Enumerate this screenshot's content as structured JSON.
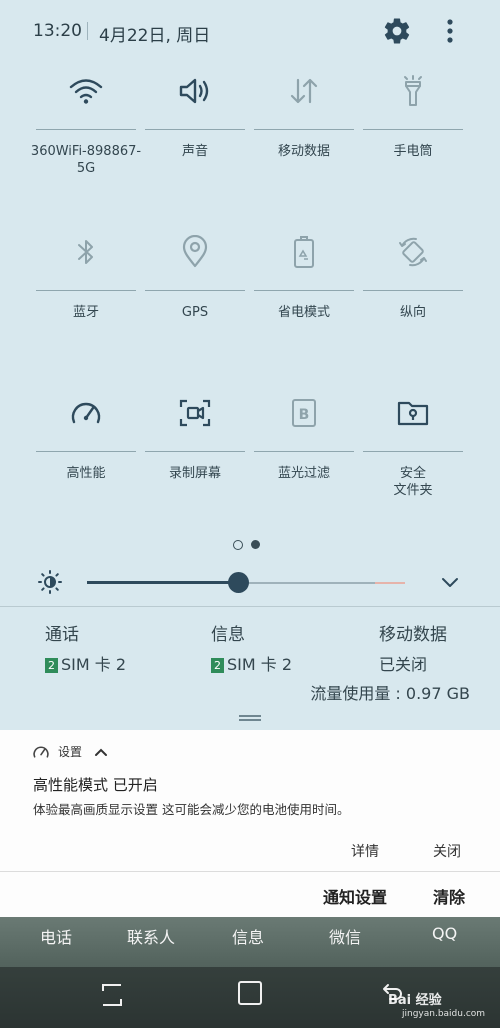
{
  "status": {
    "time": "13:20",
    "date": "4月22日, 周日"
  },
  "tiles": [
    {
      "icon": "wifi-icon",
      "label": "360WiFi-898867-5G",
      "active": true
    },
    {
      "icon": "sound-icon",
      "label": "声音",
      "active": true
    },
    {
      "icon": "mobile-data-icon",
      "label": "移动数据",
      "active": false
    },
    {
      "icon": "flashlight-icon",
      "label": "手电筒",
      "active": false
    },
    {
      "icon": "bluetooth-icon",
      "label": "蓝牙",
      "active": false
    },
    {
      "icon": "gps-icon",
      "label": "GPS",
      "active": false
    },
    {
      "icon": "battery-saver-icon",
      "label": "省电模式",
      "active": false
    },
    {
      "icon": "rotation-icon",
      "label": "纵向",
      "active": false
    },
    {
      "icon": "performance-icon",
      "label": "高性能",
      "active": true
    },
    {
      "icon": "screen-record-icon",
      "label": "录制屏幕",
      "active": true
    },
    {
      "icon": "blue-light-filter-icon",
      "label": "蓝光过滤",
      "active": false
    },
    {
      "icon": "secure-folder-icon",
      "label": "安全\n文件夹",
      "active": true
    }
  ],
  "page_indicator": {
    "pages": 2,
    "current": 2
  },
  "brightness": {
    "level": 0.46
  },
  "sim": {
    "call": {
      "label": "通话",
      "badge": "2",
      "sim": "SIM 卡 2"
    },
    "message": {
      "label": "信息",
      "badge": "2",
      "sim": "SIM 卡 2"
    },
    "data": {
      "label": "移动数据",
      "status": "已关闭"
    },
    "usage": "流量使用量 : 0.97 GB"
  },
  "notification": {
    "app": "设置",
    "title": "高性能模式 已开启",
    "text": "体验最高画质显示设置 这可能会减少您的电池使用时间。",
    "detail_btn": "详情",
    "close_btn": "关闭"
  },
  "actions": {
    "settings": "通知设置",
    "clear": "清除"
  },
  "dock": [
    "电话",
    "联系人",
    "信息",
    "微信",
    "QQ"
  ],
  "watermark": {
    "brand": "Bai 经验",
    "url": "jingyan.baidu.com"
  },
  "colors": {
    "panel": "#d8e8ee",
    "icon_active": "#2e4a5c",
    "icon_inactive": "#8ea3ab",
    "sim_badge": "#2f8c5a"
  }
}
